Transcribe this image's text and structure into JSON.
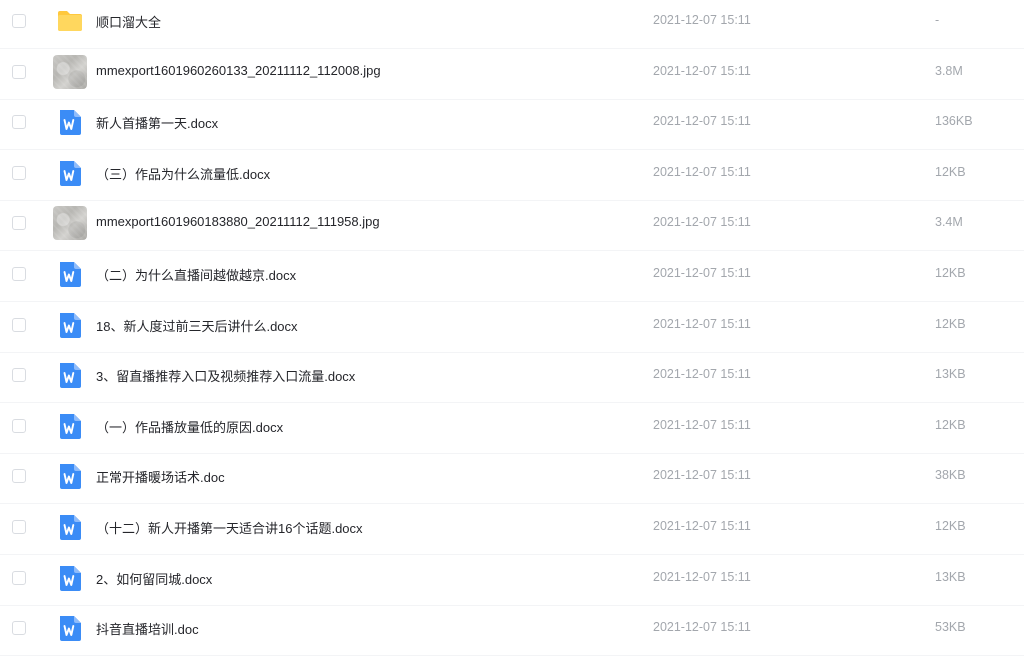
{
  "files": [
    {
      "type": "folder",
      "icon": "folder-icon",
      "name": "顺口溜大全",
      "date": "2021-12-07 15:11",
      "size": "-"
    },
    {
      "type": "image",
      "icon": "image-thumbnail",
      "name": "mmexport1601960260133_20211112_112008.jpg",
      "date": "2021-12-07 15:11",
      "size": "3.8M"
    },
    {
      "type": "word",
      "icon": "word-doc-icon",
      "name": "新人首播第一天.docx",
      "date": "2021-12-07 15:11",
      "size": "136KB"
    },
    {
      "type": "word",
      "icon": "word-doc-icon",
      "name": "（三）作品为什么流量低.docx",
      "date": "2021-12-07 15:11",
      "size": "12KB"
    },
    {
      "type": "image",
      "icon": "image-thumbnail",
      "name": "mmexport1601960183880_20211112_111958.jpg",
      "date": "2021-12-07 15:11",
      "size": "3.4M"
    },
    {
      "type": "word",
      "icon": "word-doc-icon",
      "name": "（二）为什么直播间越做越京.docx",
      "date": "2021-12-07 15:11",
      "size": "12KB"
    },
    {
      "type": "word",
      "icon": "word-doc-icon",
      "name": "18、新人度过前三天后讲什么.docx",
      "date": "2021-12-07 15:11",
      "size": "12KB"
    },
    {
      "type": "word",
      "icon": "word-doc-icon",
      "name": "3、留直播推荐入口及视频推荐入口流量.docx",
      "date": "2021-12-07 15:11",
      "size": "13KB"
    },
    {
      "type": "word",
      "icon": "word-doc-icon",
      "name": "（一）作品播放量低的原因.docx",
      "date": "2021-12-07 15:11",
      "size": "12KB"
    },
    {
      "type": "word",
      "icon": "word-doc-icon",
      "name": "正常开播暖场话术.doc",
      "date": "2021-12-07 15:11",
      "size": "38KB"
    },
    {
      "type": "word",
      "icon": "word-doc-icon",
      "name": "（十二）新人开播第一天适合讲16个话题.docx",
      "date": "2021-12-07 15:11",
      "size": "12KB"
    },
    {
      "type": "word",
      "icon": "word-doc-icon",
      "name": "2、如何留同城.docx",
      "date": "2021-12-07 15:11",
      "size": "13KB"
    },
    {
      "type": "word",
      "icon": "word-doc-icon",
      "name": "抖音直播培训.doc",
      "date": "2021-12-07 15:11",
      "size": "53KB"
    }
  ],
  "colors": {
    "folder": "#ffd24a",
    "word_icon": "#3b8cf6",
    "text": "#25262b",
    "muted": "#a3a7ad"
  }
}
